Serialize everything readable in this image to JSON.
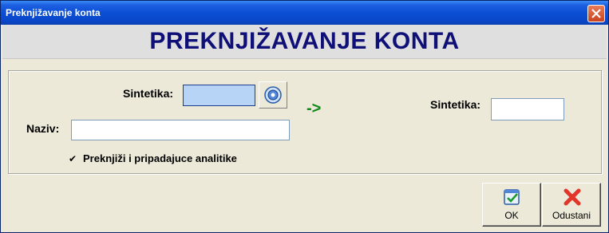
{
  "window": {
    "title": "Preknjižavanje konta"
  },
  "header": {
    "title": "PREKNJIŽAVANJE KONTA"
  },
  "form": {
    "source_label": "Sintetika:",
    "source_value": "",
    "naziv_label": "Naziv:",
    "naziv_value": "",
    "arrow": "->",
    "target_label": "Sintetika:",
    "target_value": "",
    "checkbox_checked": true,
    "checkbox_label": "Preknjiži i pripadajuce analitike"
  },
  "buttons": {
    "ok_label": "OK",
    "cancel_label": "Odustani"
  },
  "colors": {
    "header_text": "#0f0f78",
    "arrow": "#0f8a1a",
    "titlebar": "#0b4fd6"
  },
  "icons": {
    "picker": "lookup-icon",
    "ok": "ok-check-icon",
    "cancel": "cancel-x-icon"
  }
}
